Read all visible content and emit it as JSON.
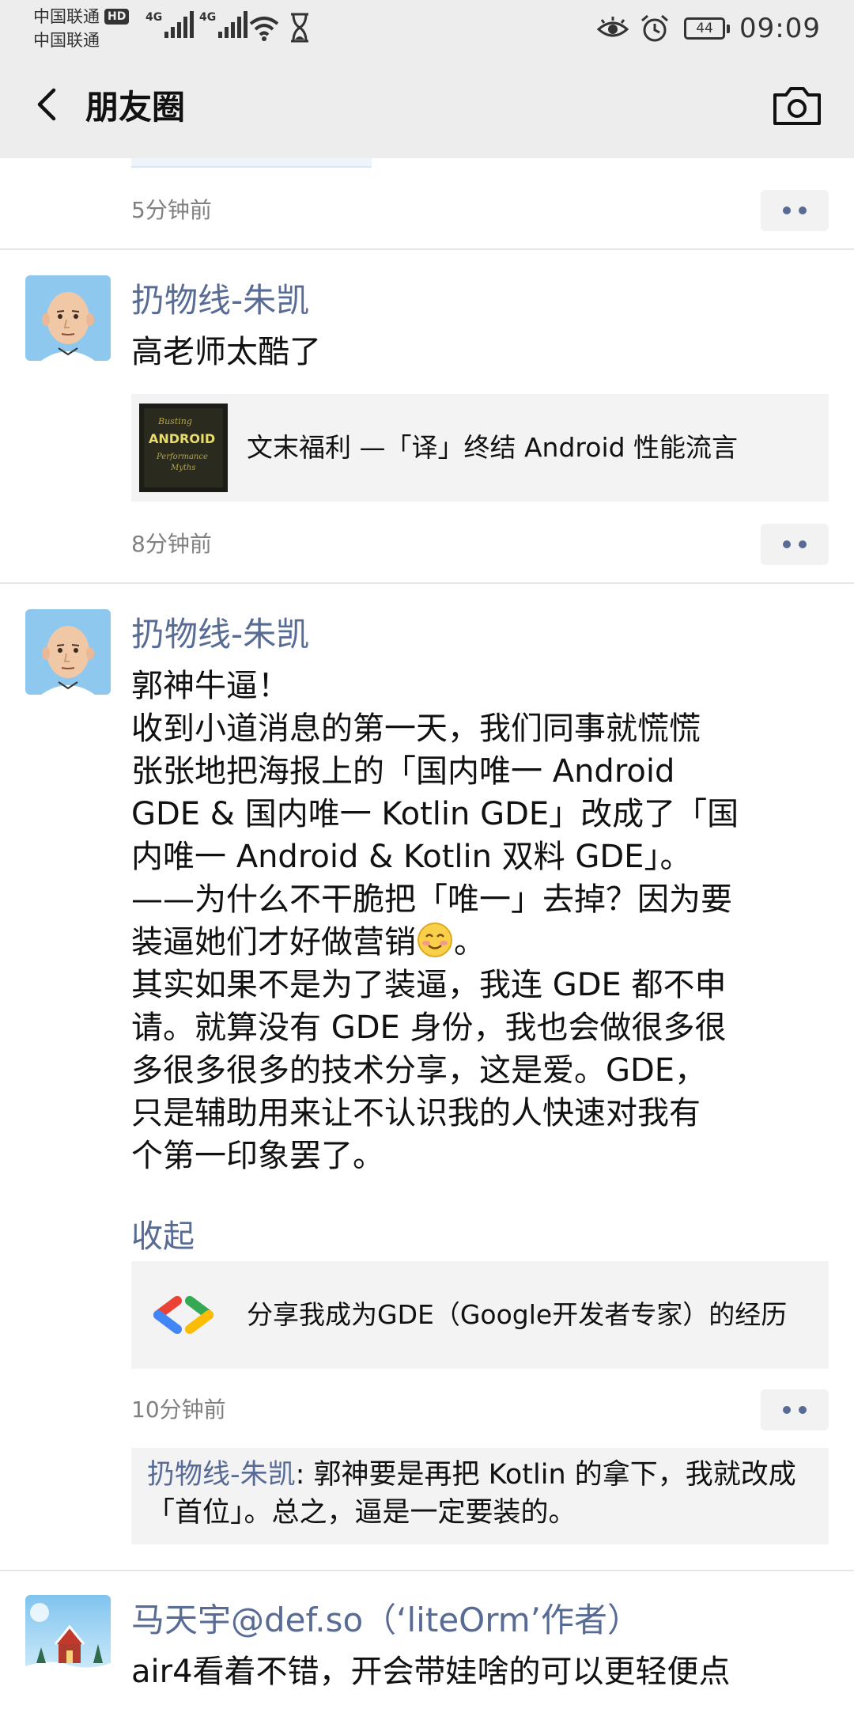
{
  "status_bar": {
    "carrier_1": "中国联通",
    "carrier_2": "中国联通",
    "hd_badge": "HD",
    "network_1": "4G",
    "network_2": "4G",
    "battery": "44",
    "time": "09:09"
  },
  "title_bar": {
    "title": "朋友圈"
  },
  "posts": [
    {
      "time": "5分钟前"
    },
    {
      "nickname": "扔物线-朱凯",
      "text": "高老师太酷了",
      "link_card": {
        "thumb_text": [
          "Busting",
          "ANDROID",
          "Performance",
          "Myths"
        ],
        "title": "文末福利 —「译」终结 Android 性能流言"
      },
      "time": "8分钟前"
    },
    {
      "nickname": "扔物线-朱凯",
      "text_lines": [
        "郭神牛逼！",
        "收到小道消息的第一天，我们同事就慌慌",
        "张张地把海报上的「国内唯一 Android",
        "GDE & 国内唯一 Kotlin GDE」改成了「国",
        "内唯一 Android & Kotlin 双料 GDE」。",
        "——为什么不干脆把「唯一」去掉？因为要",
        "装逼她们才好做营销",
        "。",
        "其实如果不是为了装逼，我连 GDE 都不申",
        "请。就算没有 GDE 身份，我也会做很多很",
        "多很多很多的技术分享，这是爱。GDE，",
        "只是辅助用来让不认识我的人快速对我有",
        "个第一印象罢了。"
      ],
      "collapse_label": "收起",
      "link_card": {
        "title": "分享我成为GDE（Google开发者专家）的经历"
      },
      "time": "10分钟前",
      "comment": {
        "author": "扔物线-朱凯",
        "text": ": 郭神要是再把 Kotlin 的拿下，我就改成「首位」。总之，逼是一定要装的。"
      }
    },
    {
      "nickname": "马天宇@def.so（‘liteOrm’作者）",
      "text": "air4看着不错，开会带娃啥的可以更轻便点"
    }
  ],
  "icons": {
    "back": "chevron-left-icon",
    "camera": "camera-icon",
    "eye_comfort": "eye-icon",
    "alarm": "alarm-icon",
    "wifi": "wifi-icon",
    "hourglass": "hourglass-icon"
  },
  "colors": {
    "link_blue": "#576b95",
    "header_bg": "#ededed",
    "card_bg": "#f3f3f3"
  }
}
